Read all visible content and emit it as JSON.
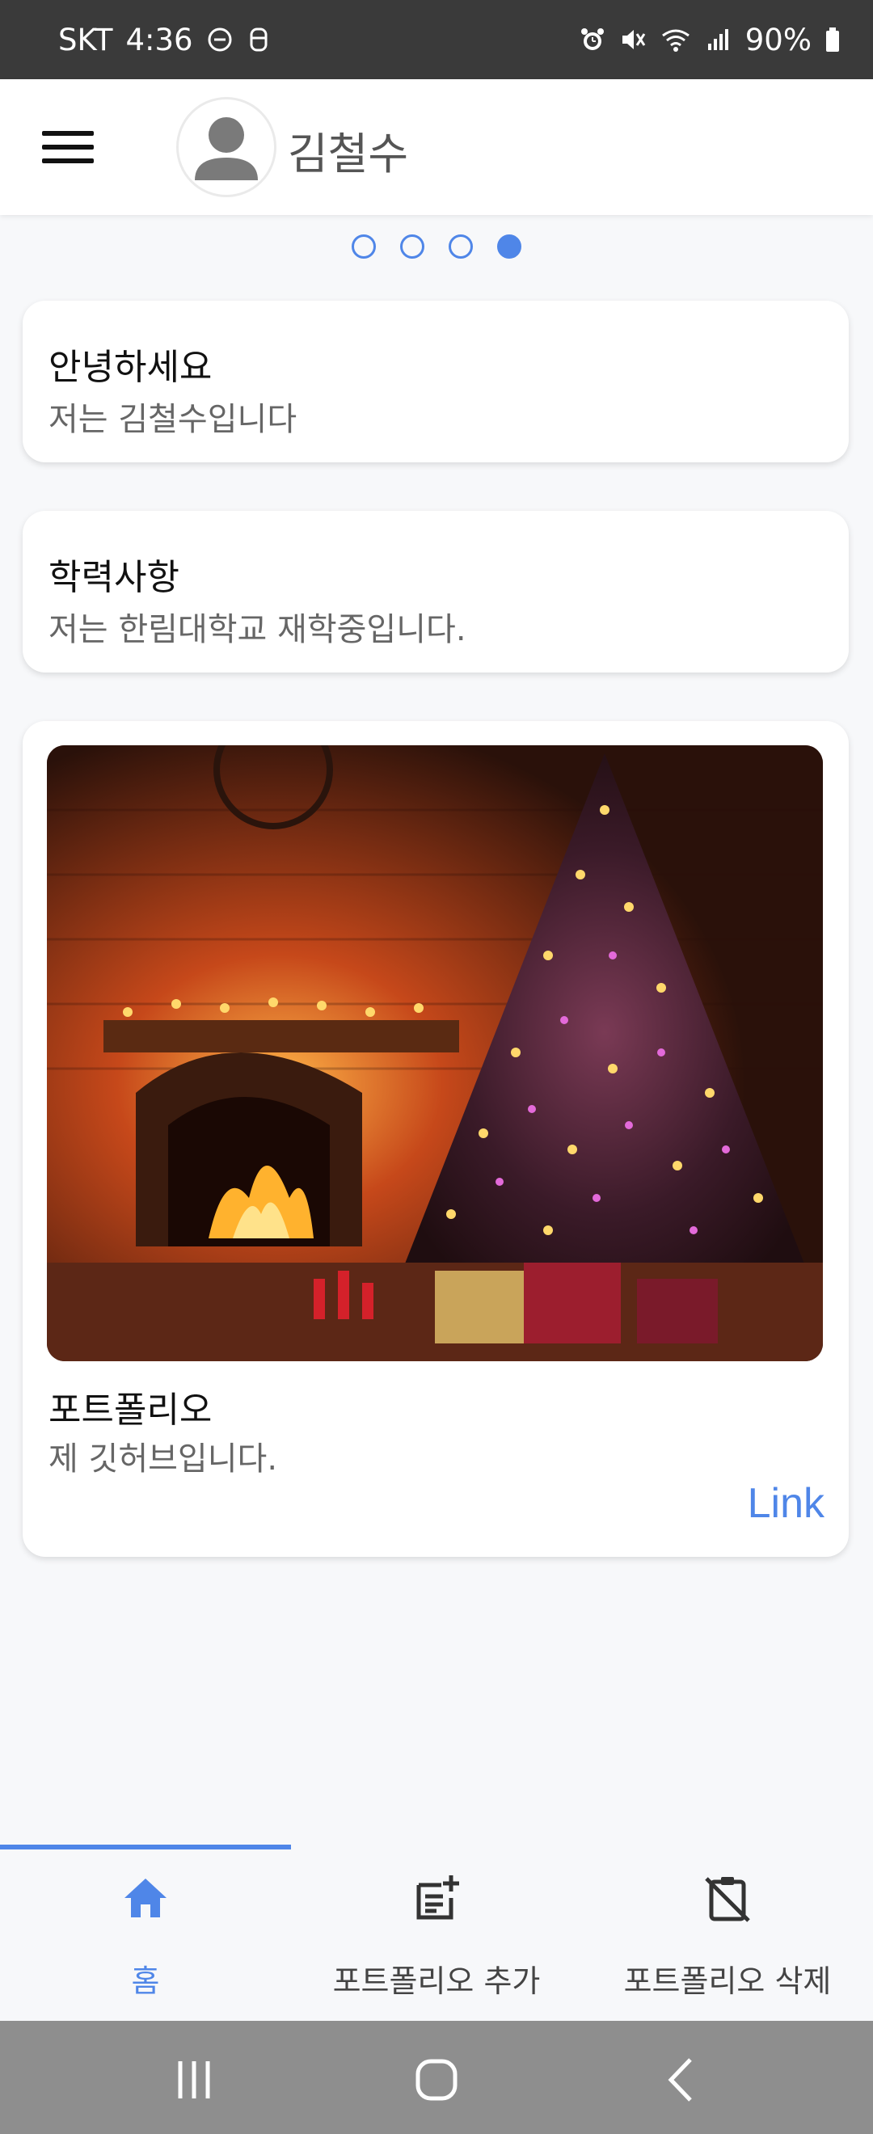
{
  "status_bar": {
    "carrier": "SKT",
    "time": "4:36",
    "battery": "90%",
    "icons": [
      "dnd-icon",
      "cloud-icon",
      "alarm-icon",
      "mute-icon",
      "wifi-icon",
      "signal-icon",
      "battery-icon"
    ]
  },
  "header": {
    "user_name": "김철수",
    "avatar_icon": "person-icon",
    "menu_icon": "hamburger-menu-icon"
  },
  "pager": {
    "total": 4,
    "active_index": 3
  },
  "cards": [
    {
      "title": "안녕하세요",
      "subtitle": "저는 김철수입니다"
    },
    {
      "title": "학력사항",
      "subtitle": "저는 한림대학교 재학중입니다."
    },
    {
      "title": "포트폴리오",
      "subtitle": "제 깃허브입니다.",
      "link_label": "Link"
    }
  ],
  "bottom_nav": {
    "items": [
      {
        "label": "홈",
        "icon": "home-icon",
        "active": true
      },
      {
        "label": "포트폴리오 추가",
        "icon": "note-add-icon",
        "active": false
      },
      {
        "label": "포트폴리오 삭제",
        "icon": "clipboard-off-icon",
        "active": false
      }
    ]
  },
  "colors": {
    "accent": "#4f86e8",
    "status_bar": "#3a3a3a",
    "system_nav": "#8e8e8e"
  }
}
